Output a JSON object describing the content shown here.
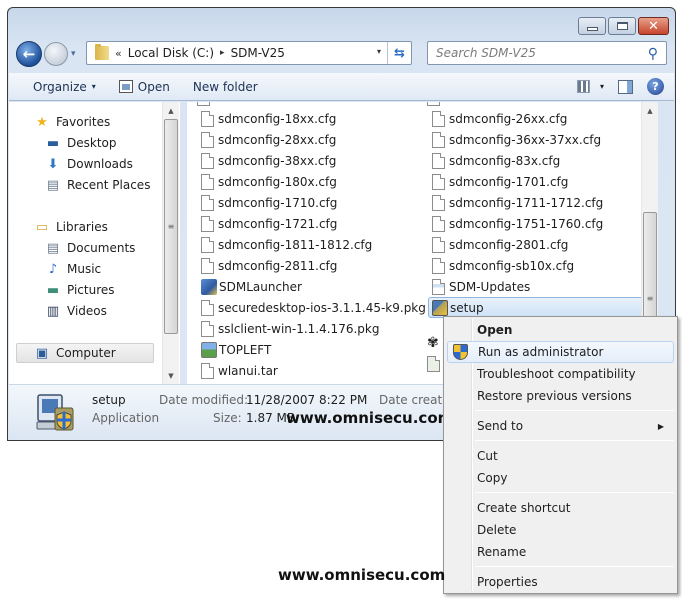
{
  "window": {
    "caption_buttons": {
      "minimize": "minimize",
      "maximize": "maximize",
      "close": "✕"
    }
  },
  "navigation": {
    "back_icon": "←",
    "history_icon": "▾",
    "breadcrumb_prefix": "«",
    "breadcrumbs": [
      "Local Disk (C:)",
      "SDM-V25"
    ],
    "crumb_separator": "▸",
    "address_dropdown": "▾",
    "refresh_icon": "⇆",
    "search_placeholder": "Search SDM-V25",
    "search_icon": "⚲"
  },
  "toolbar": {
    "organize_label": "Organize",
    "organize_arrow": "▾",
    "open_label": "Open",
    "new_folder_label": "New folder",
    "views_arrow": "▾",
    "help_icon": "?"
  },
  "nav_pane": {
    "groups": [
      {
        "label": "Favorites",
        "icon": "★",
        "items": [
          {
            "label": "Desktop",
            "icon": "▬"
          },
          {
            "label": "Downloads",
            "icon": "⬇"
          },
          {
            "label": "Recent Places",
            "icon": "▤"
          }
        ]
      },
      {
        "label": "Libraries",
        "icon": "▭",
        "items": [
          {
            "label": "Documents",
            "icon": "▤"
          },
          {
            "label": "Music",
            "icon": "♪"
          },
          {
            "label": "Pictures",
            "icon": "▬"
          },
          {
            "label": "Videos",
            "icon": "▥"
          }
        ]
      },
      {
        "label": "Computer",
        "icon": "▣",
        "items": []
      }
    ],
    "selected": "Computer",
    "scroll_up": "▲",
    "scroll_down": "▼",
    "grip": "≡"
  },
  "files": {
    "column1": [
      {
        "name": "sdmconfig-18xx.cfg",
        "type": "file"
      },
      {
        "name": "sdmconfig-28xx.cfg",
        "type": "file"
      },
      {
        "name": "sdmconfig-38xx.cfg",
        "type": "file"
      },
      {
        "name": "sdmconfig-180x.cfg",
        "type": "file"
      },
      {
        "name": "sdmconfig-1710.cfg",
        "type": "file"
      },
      {
        "name": "sdmconfig-1721.cfg",
        "type": "file"
      },
      {
        "name": "sdmconfig-1811-1812.cfg",
        "type": "file"
      },
      {
        "name": "sdmconfig-2811.cfg",
        "type": "file"
      },
      {
        "name": "SDMLauncher",
        "type": "app"
      },
      {
        "name": "securedesktop-ios-3.1.1.45-k9.pkg",
        "type": "file"
      },
      {
        "name": "sslclient-win-1.1.4.176.pkg",
        "type": "file"
      },
      {
        "name": "TOPLEFT",
        "type": "image"
      },
      {
        "name": "wlanui.tar",
        "type": "file"
      }
    ],
    "column2": [
      {
        "name": "sdmconfig-26xx.cfg",
        "type": "file"
      },
      {
        "name": "sdmconfig-36xx-37xx.cfg",
        "type": "file"
      },
      {
        "name": "sdmconfig-83x.cfg",
        "type": "file"
      },
      {
        "name": "sdmconfig-1701.cfg",
        "type": "file"
      },
      {
        "name": "sdmconfig-1711-1712.cfg",
        "type": "file"
      },
      {
        "name": "sdmconfig-1751-1760.cfg",
        "type": "file"
      },
      {
        "name": "sdmconfig-2801.cfg",
        "type": "file"
      },
      {
        "name": "sdmconfig-sb10x.cfg",
        "type": "file"
      },
      {
        "name": "SDM-Updates",
        "type": "config"
      },
      {
        "name": "setup",
        "type": "setup",
        "selected": true
      }
    ],
    "scroll_up": "▲",
    "scroll_down": "▼",
    "grip": "≡"
  },
  "details": {
    "name": "setup",
    "type": "Application",
    "date_modified_label": "Date modified:",
    "date_modified": "11/28/2007 8:22 PM",
    "date_created_label": "Date created",
    "size_label": "Size:",
    "size": "1.87 MB",
    "watermark": "www.omnisecu.com"
  },
  "context_menu": {
    "items": [
      {
        "label": "Open",
        "bold": true
      },
      {
        "label": "Run as administrator",
        "highlighted": true,
        "icon": "uac-shield"
      },
      {
        "label": "Troubleshoot compatibility"
      },
      {
        "label": "Restore previous versions"
      },
      {
        "label": "Send to",
        "submenu": true
      },
      {
        "label": "Cut"
      },
      {
        "label": "Copy"
      },
      {
        "label": "Create shortcut"
      },
      {
        "label": "Delete"
      },
      {
        "label": "Rename"
      },
      {
        "label": "Properties"
      }
    ],
    "submenu_arrow": "▶"
  },
  "footer_watermark": "www.omnisecu.com"
}
